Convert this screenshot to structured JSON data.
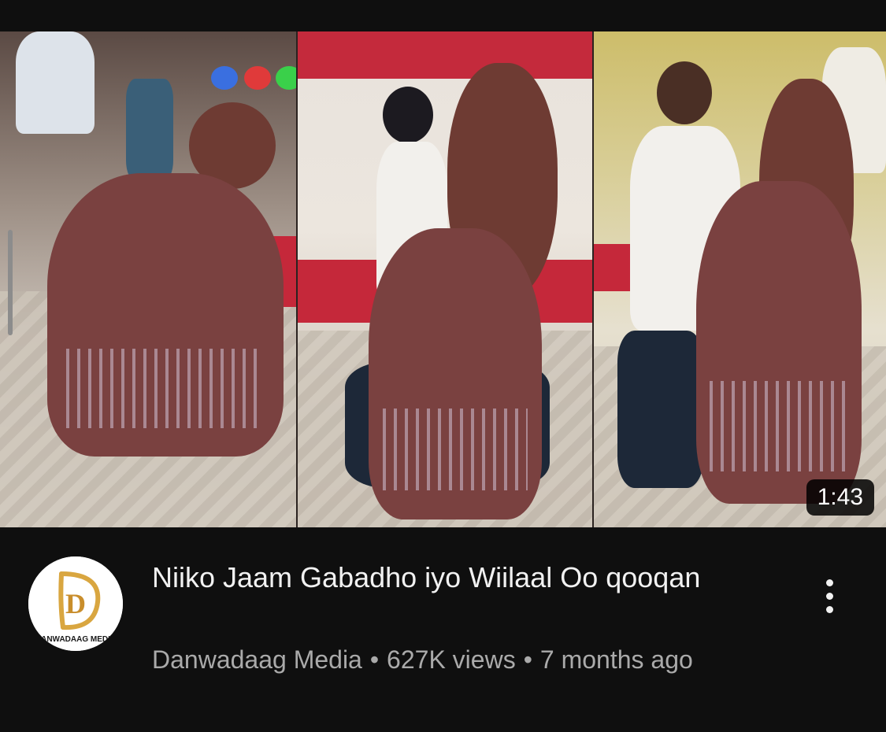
{
  "video": {
    "duration": "1:43",
    "title": "Niiko Jaam Gabadho iyo Wiilaal Oo qooqan",
    "channel": "Danwadaag Media",
    "views": "627K views",
    "age": "7 months ago",
    "separator": "•"
  },
  "avatar": {
    "logo_letter": "D",
    "logo_text": "DANWADAAG MEDIA"
  },
  "colors": {
    "background": "#0f0f0f",
    "title": "#f1f1f1",
    "secondary_text": "#aaaaaa",
    "logo_gold": "#d9a640"
  },
  "icons": {
    "more": "vertical-dots-icon"
  }
}
